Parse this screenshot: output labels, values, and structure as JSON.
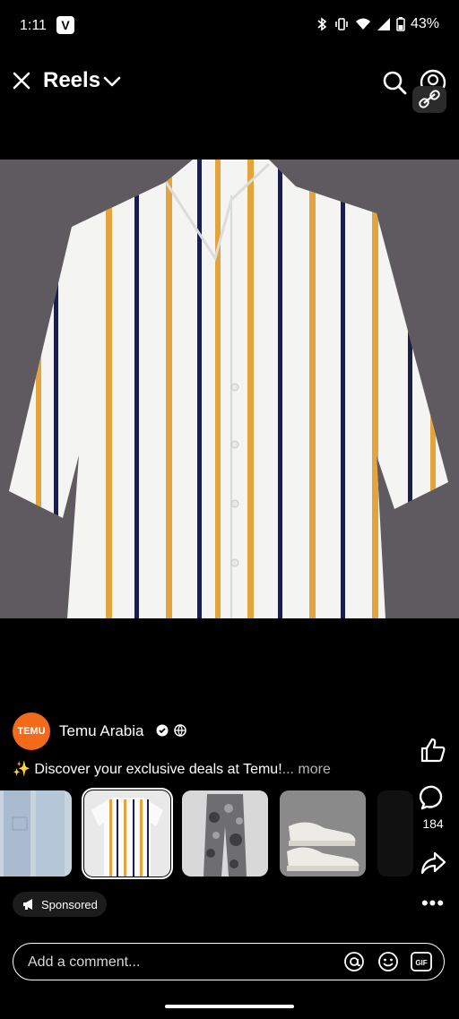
{
  "status_bar": {
    "time": "1:11",
    "app_badge": "V",
    "battery": "43%"
  },
  "header": {
    "title": "Reels"
  },
  "post": {
    "author": "Temu Arabia",
    "avatar_text": "TEMU",
    "caption": "✨ Discover your exclusive deals at Temu!",
    "caption_more": "... more",
    "comment_count": "184"
  },
  "products": [
    {
      "name": "jeans"
    },
    {
      "name": "striped-shirt",
      "selected": true
    },
    {
      "name": "camo-pants"
    },
    {
      "name": "sneakers"
    }
  ],
  "sponsored_label": "Sponsored",
  "comment_input": {
    "placeholder": "Add a comment..."
  },
  "colors": {
    "background": "#000000",
    "temu_orange": "#f36a1b",
    "stripe_gold": "#e3a43e",
    "stripe_navy": "#1b1d4a"
  },
  "icons": [
    "close-icon",
    "chevron-down-icon",
    "search-icon",
    "profile-icon",
    "link-icon",
    "verified-icon",
    "globe-icon",
    "like-icon",
    "comment-icon",
    "share-icon",
    "more-icon",
    "megaphone-icon",
    "at-icon",
    "emoji-icon",
    "gif-icon"
  ]
}
